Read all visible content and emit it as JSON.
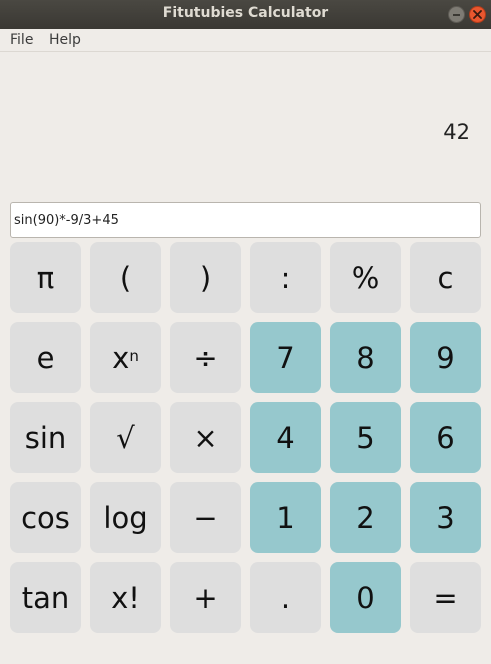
{
  "window": {
    "title": "Fitutubies Calculator"
  },
  "menu": {
    "file": "File",
    "help": "Help"
  },
  "display": {
    "result": "42",
    "expression": "sin(90)*-9/3+45"
  },
  "keys": {
    "r0": [
      "π",
      "(",
      ")",
      ":",
      "%",
      "c"
    ],
    "r1": [
      "e",
      "x",
      "÷",
      "7",
      "8",
      "9"
    ],
    "r1_power_sup": "n",
    "r2": [
      "sin",
      "√",
      "×",
      "4",
      "5",
      "6"
    ],
    "r3": [
      "cos",
      "log",
      "−",
      "1",
      "2",
      "3"
    ],
    "r4": [
      "tan",
      "x!",
      "+",
      ".",
      "0",
      "="
    ]
  },
  "colors": {
    "titlebar": "#3e3c37",
    "background": "#efece8",
    "function_key": "#dedede",
    "digit_key": "#96c8cd",
    "close_button": "#e9572f"
  }
}
